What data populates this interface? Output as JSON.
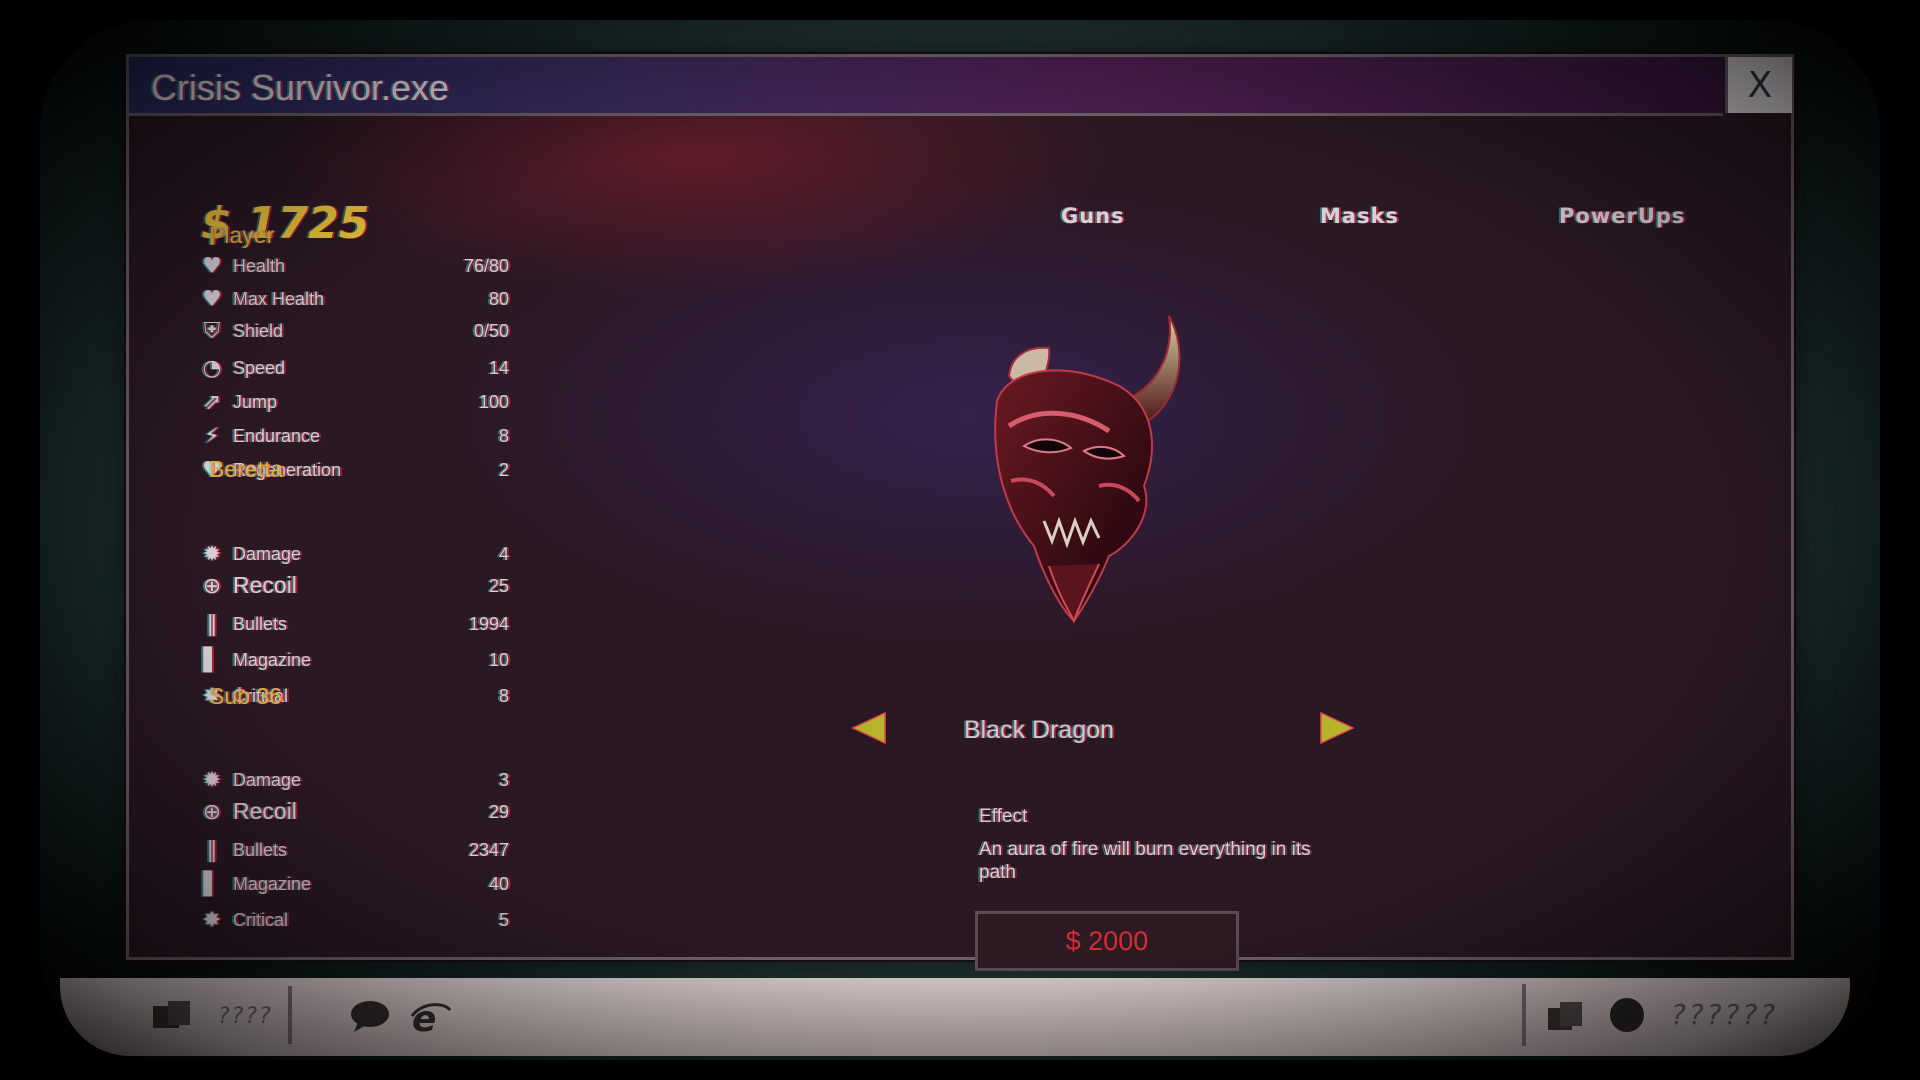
{
  "window": {
    "title": "Crisis Survivor.exe",
    "close_label": "X"
  },
  "money": "$ 1725",
  "tabs": [
    {
      "label": "Guns"
    },
    {
      "label": "Masks"
    },
    {
      "label": "PowerUps"
    }
  ],
  "player": {
    "title": "Player",
    "stats": [
      {
        "label": "Health",
        "value": "76/80",
        "icon": "heart-icon"
      },
      {
        "label": "Max Health",
        "value": "80",
        "icon": "heart-plus-icon"
      },
      {
        "label": "Shield",
        "value": "0/50",
        "icon": "shield-icon"
      },
      {
        "label": "Speed",
        "value": "14",
        "icon": "speedometer-icon"
      },
      {
        "label": "Jump",
        "value": "100",
        "icon": "jump-icon"
      },
      {
        "label": "Endurance",
        "value": "8",
        "icon": "lightning-icon"
      },
      {
        "label": "Regeneration",
        "value": "2",
        "icon": "heart-regen-icon"
      }
    ]
  },
  "beretta": {
    "title": "Beretta",
    "stats": [
      {
        "label": "Damage",
        "value": "4",
        "icon": "explosion-icon"
      },
      {
        "label": "Recoil",
        "value": "25",
        "icon": "crosshair-icon"
      },
      {
        "label": "Bullets",
        "value": "1994",
        "icon": "bullets-icon"
      },
      {
        "label": "Magazine",
        "value": "10",
        "icon": "magazine-icon"
      },
      {
        "label": "Critical",
        "value": "8",
        "icon": "critical-icon"
      }
    ]
  },
  "sub36": {
    "title": "Sub 36",
    "stats": [
      {
        "label": "Damage",
        "value": "3",
        "icon": "explosion-icon"
      },
      {
        "label": "Recoil",
        "value": "29",
        "icon": "crosshair-icon"
      },
      {
        "label": "Bullets",
        "value": "2347",
        "icon": "bullets-icon"
      },
      {
        "label": "Magazine",
        "value": "40",
        "icon": "magazine-icon"
      },
      {
        "label": "Critical",
        "value": "5",
        "icon": "critical-icon"
      }
    ]
  },
  "item": {
    "name": "Black Dragon",
    "effect_label": "Effect",
    "effect_text": "An aura of fire will burn everything in its path",
    "price": "$ 2000"
  },
  "taskbar": {
    "start_label": "????",
    "tray_label": "??????"
  },
  "colors": {
    "money": "#e7c13a",
    "section": "#d9b33a",
    "price": "#d62c35",
    "arrow": "#b7b32a"
  }
}
